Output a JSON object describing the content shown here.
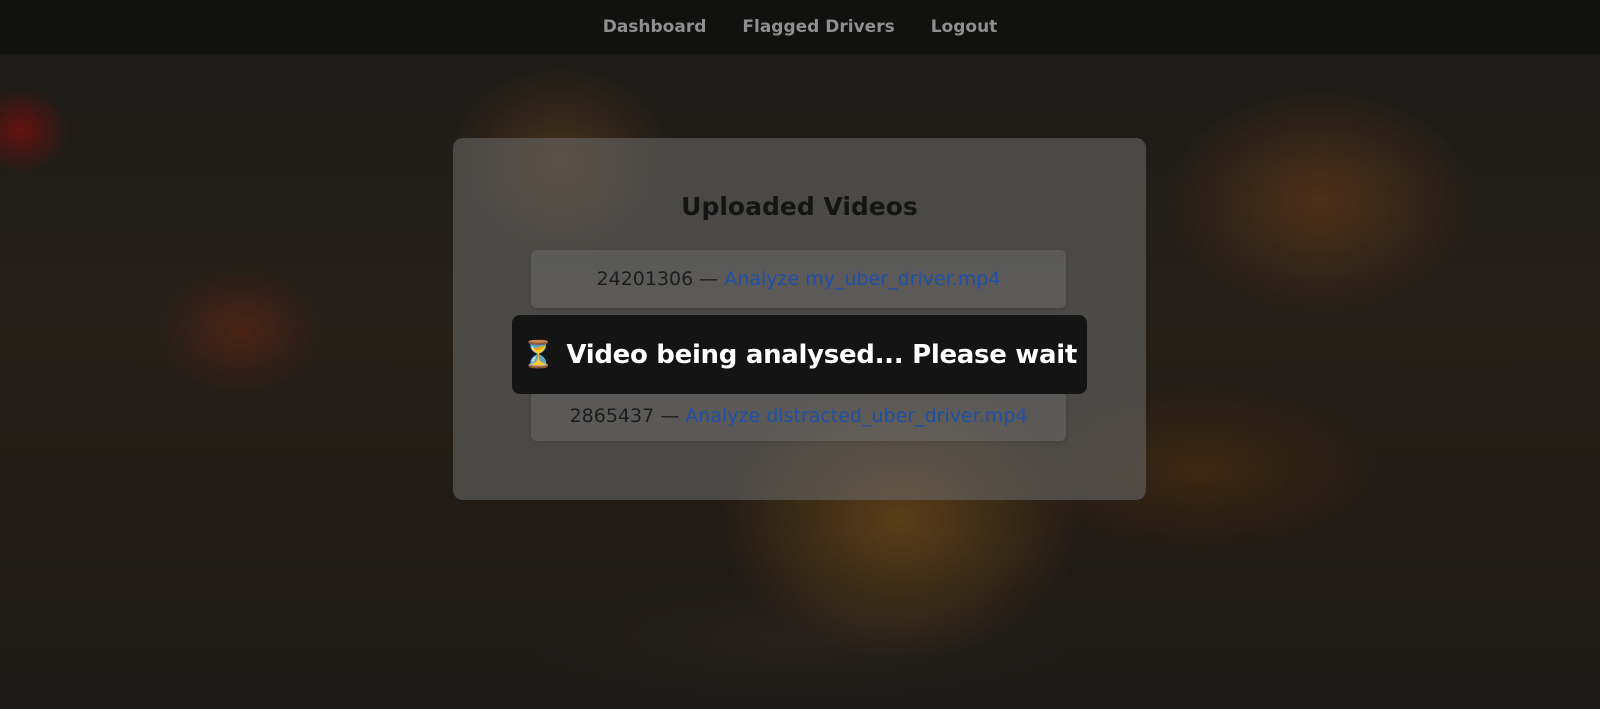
{
  "nav": {
    "items": [
      {
        "label": "Dashboard"
      },
      {
        "label": "Flagged Drivers"
      },
      {
        "label": "Logout"
      }
    ]
  },
  "main": {
    "title": "Uploaded Videos",
    "videos": [
      {
        "id": "24201306",
        "separator": " — ",
        "link_label": "Analyze my_uber_driver.mp4"
      },
      {
        "id": "2865437",
        "separator": " — ",
        "link_label": "Analyze distracted_uber_driver.mp4"
      }
    ]
  },
  "toast": {
    "icon": "hourglass-icon",
    "glyph": "⏳",
    "message": "Video being analysed... Please wait"
  },
  "colors": {
    "link": "#1f4fa6",
    "toast_bg": "#141414",
    "nav_text": "#8f8f8f"
  }
}
